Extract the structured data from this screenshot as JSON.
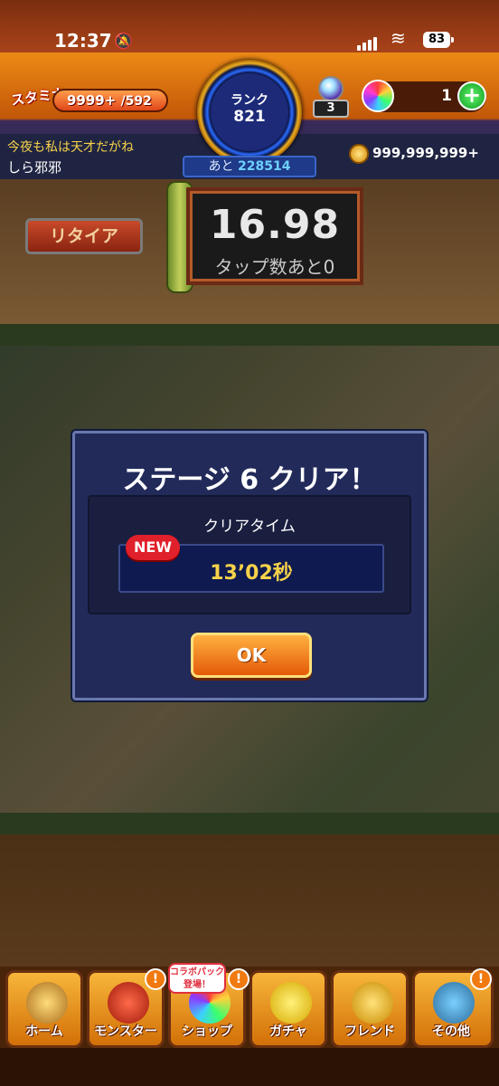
{
  "status_bar": {
    "time": "12:37",
    "battery": "83"
  },
  "header": {
    "stamina_label": "スタミナ",
    "stamina_current": "9999+",
    "stamina_max": "/592",
    "rank_label": "ランク",
    "rank_value": "821",
    "rank_next_label": "あと",
    "rank_next_value": "228514",
    "gem_count": "3",
    "orb_count": "1",
    "player_message": "今夜も私は天才だがね",
    "player_name": "しら邪邪",
    "gold_amount": "999,999,999+"
  },
  "battle": {
    "retire_label": "リタイア",
    "timer_value": "16.98",
    "tap_remaining": "タップ数あと0"
  },
  "dialog": {
    "title": "ステージ 6 クリア！",
    "clear_time_label": "クリアタイム",
    "new_badge": "NEW",
    "clear_time_value": "13’02秒",
    "ok_label": "OK"
  },
  "nav": {
    "collab_tag": "コラボパック\n登場！",
    "items": [
      {
        "label": "ホーム",
        "icon": "home-icon"
      },
      {
        "label": "モンスター",
        "icon": "monster-icon"
      },
      {
        "label": "ショップ",
        "icon": "shop-icon"
      },
      {
        "label": "ガチャ",
        "icon": "gacha-icon"
      },
      {
        "label": "フレンド",
        "icon": "friend-icon"
      },
      {
        "label": "その他",
        "icon": "other-icon"
      }
    ],
    "alert_mark": "!"
  },
  "colors": {
    "accent_orange": "#e45a08",
    "dialog_bg": "#222a5a",
    "clear_time_text": "#f7d24a",
    "new_badge": "#e0202a"
  }
}
